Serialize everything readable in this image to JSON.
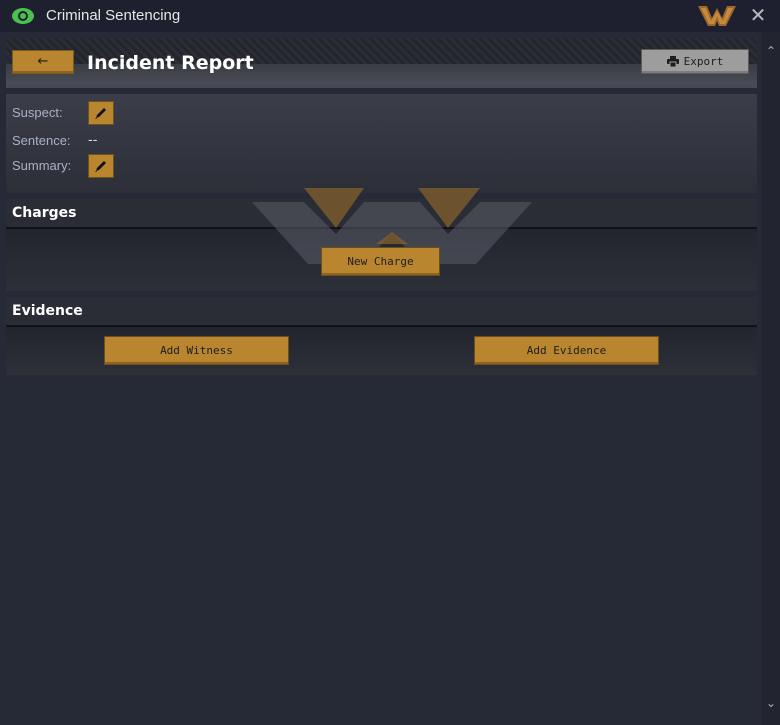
{
  "window": {
    "title": "Criminal Sentencing",
    "close_symbol": "✕"
  },
  "header": {
    "back_symbol": "←",
    "title": "Incident Report",
    "export_label": "Export"
  },
  "info": {
    "suspect_label": "Suspect:",
    "sentence_label": "Sentence:",
    "sentence_value": "--",
    "summary_label": "Summary:"
  },
  "charges": {
    "title": "Charges",
    "new_charge_label": "New Charge"
  },
  "evidence": {
    "title": "Evidence",
    "add_witness_label": "Add Witness",
    "add_evidence_label": "Add Evidence"
  },
  "scrollbar": {
    "up_symbol": "⌃",
    "down_symbol": "⌄"
  },
  "icons": [
    "eye-icon",
    "logo-icon",
    "close-icon",
    "back-arrow-icon",
    "printer-icon",
    "pencil-icon",
    "watermark-logo"
  ],
  "colors": {
    "accent": "#b9862f",
    "background": "#262936",
    "titlebar": "#1e2030",
    "eye_green": "#4cc04c"
  }
}
